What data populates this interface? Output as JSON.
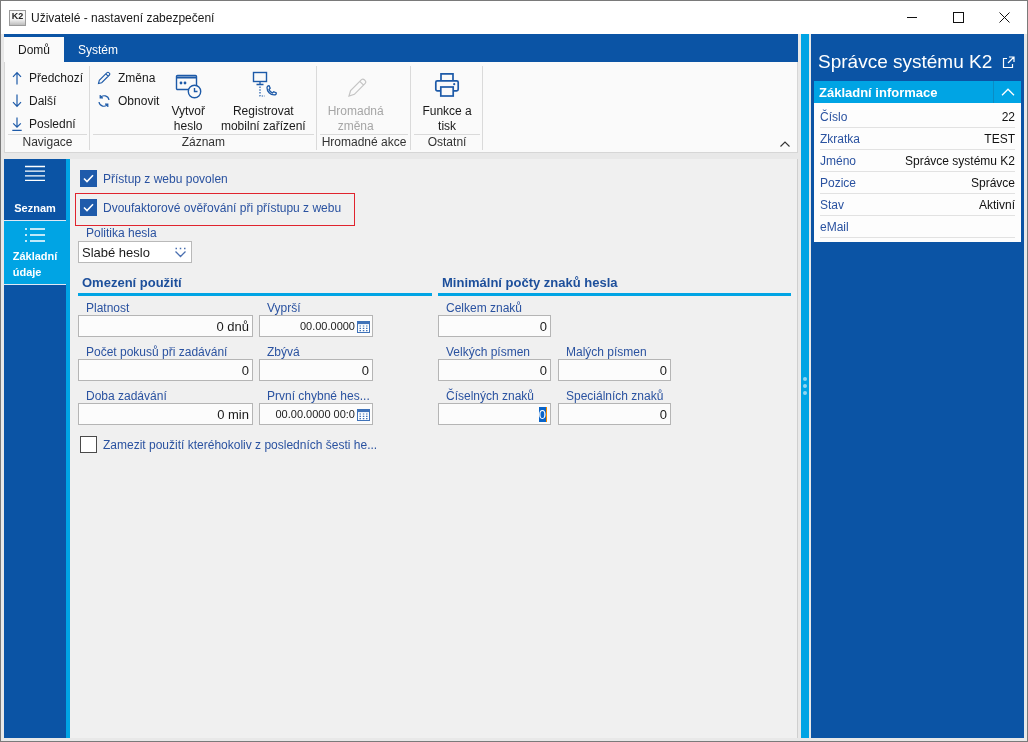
{
  "window": {
    "title": "Uživatelé - nastavení zabezpečení",
    "logo": "K2"
  },
  "ribbon": {
    "tabs": [
      {
        "label": "Domů",
        "selected": true
      },
      {
        "label": "Systém",
        "selected": false
      }
    ],
    "groups": [
      {
        "label": "Navigace",
        "items": [
          {
            "kind": "small",
            "label": "Předchozí",
            "disabled": false
          },
          {
            "kind": "small",
            "label": "Další",
            "disabled": false
          },
          {
            "kind": "small",
            "label": "Poslední",
            "disabled": false
          }
        ]
      },
      {
        "label": "Záznam",
        "items": [
          {
            "kind": "small",
            "label": "Změna",
            "disabled": false
          },
          {
            "kind": "small",
            "label": "Obnovit",
            "disabled": false
          },
          {
            "kind": "large",
            "label": "Vytvoř\nheslo",
            "disabled": false
          },
          {
            "kind": "large",
            "label": "Registrovat\nmobilní zařízení",
            "disabled": false
          }
        ]
      },
      {
        "label": "Hromadné akce",
        "items": [
          {
            "kind": "large",
            "label": "Hromadná\nzměna",
            "disabled": true
          }
        ]
      },
      {
        "label": "Ostatní",
        "items": [
          {
            "kind": "large",
            "label": "Funkce a\ntisk",
            "disabled": false
          }
        ]
      }
    ]
  },
  "navigation": [
    {
      "label": "Seznam",
      "selected": false
    },
    {
      "label": "Základní\núdaje",
      "selected": true
    }
  ],
  "form": {
    "checkboxes": [
      {
        "label": "Přístup z webu povolen",
        "checked": true,
        "highlighted": false
      },
      {
        "label": "Dvoufaktorové ověřování při přístupu z webu",
        "checked": true,
        "highlighted": true
      }
    ],
    "password_policy": {
      "label": "Politika hesla",
      "value": "Slabé heslo"
    },
    "sections": [
      {
        "title": "Omezení použití",
        "rows": [
          [
            {
              "label": "Platnost",
              "value": "0 dnů",
              "kind": "number",
              "focused": false
            },
            {
              "label": "Vyprší",
              "value": "00.00.0000",
              "kind": "date",
              "focused": false
            }
          ],
          [
            {
              "label": "Počet pokusů při zadávání",
              "value": "0",
              "kind": "number",
              "focused": false
            },
            {
              "label": "Zbývá",
              "value": "0",
              "kind": "number",
              "focused": false
            }
          ],
          [
            {
              "label": "Doba zadávání",
              "value": "0 min",
              "kind": "number",
              "focused": false
            },
            {
              "label": "První chybné hes...",
              "value": "00.00.0000 00:0",
              "kind": "date",
              "focused": false
            }
          ]
        ],
        "checkboxes": [
          {
            "label": "Zamezit použití kteréhokoliv z posledních šesti he...",
            "checked": false,
            "highlighted": false
          }
        ]
      },
      {
        "title": "Minimální počty znaků hesla",
        "rows": [
          [
            {
              "label": "Celkem znaků",
              "value": "0",
              "kind": "number",
              "focused": false
            }
          ],
          [
            {
              "label": "Velkých písmen",
              "value": "0",
              "kind": "number",
              "focused": false
            },
            {
              "label": "Malých písmen",
              "value": "0",
              "kind": "number",
              "focused": false
            }
          ],
          [
            {
              "label": "Číselných znaků",
              "value": "0",
              "kind": "number",
              "focused": true
            },
            {
              "label": "Speciálních znaků",
              "value": "0",
              "kind": "number",
              "focused": false
            }
          ]
        ]
      }
    ]
  },
  "detail_panel": {
    "title": "Správce systému K2",
    "card": {
      "title": "Základní informace",
      "expanded": true,
      "rows": [
        {
          "label": "Číslo",
          "value": "22"
        },
        {
          "label": "Zkratka",
          "value": "TEST"
        },
        {
          "label": "Jméno",
          "value": "Správce systému K2"
        },
        {
          "label": "Pozice",
          "value": "Správce"
        },
        {
          "label": "Stav",
          "value": "Aktivní"
        },
        {
          "label": "eMail"
        }
      ]
    }
  }
}
